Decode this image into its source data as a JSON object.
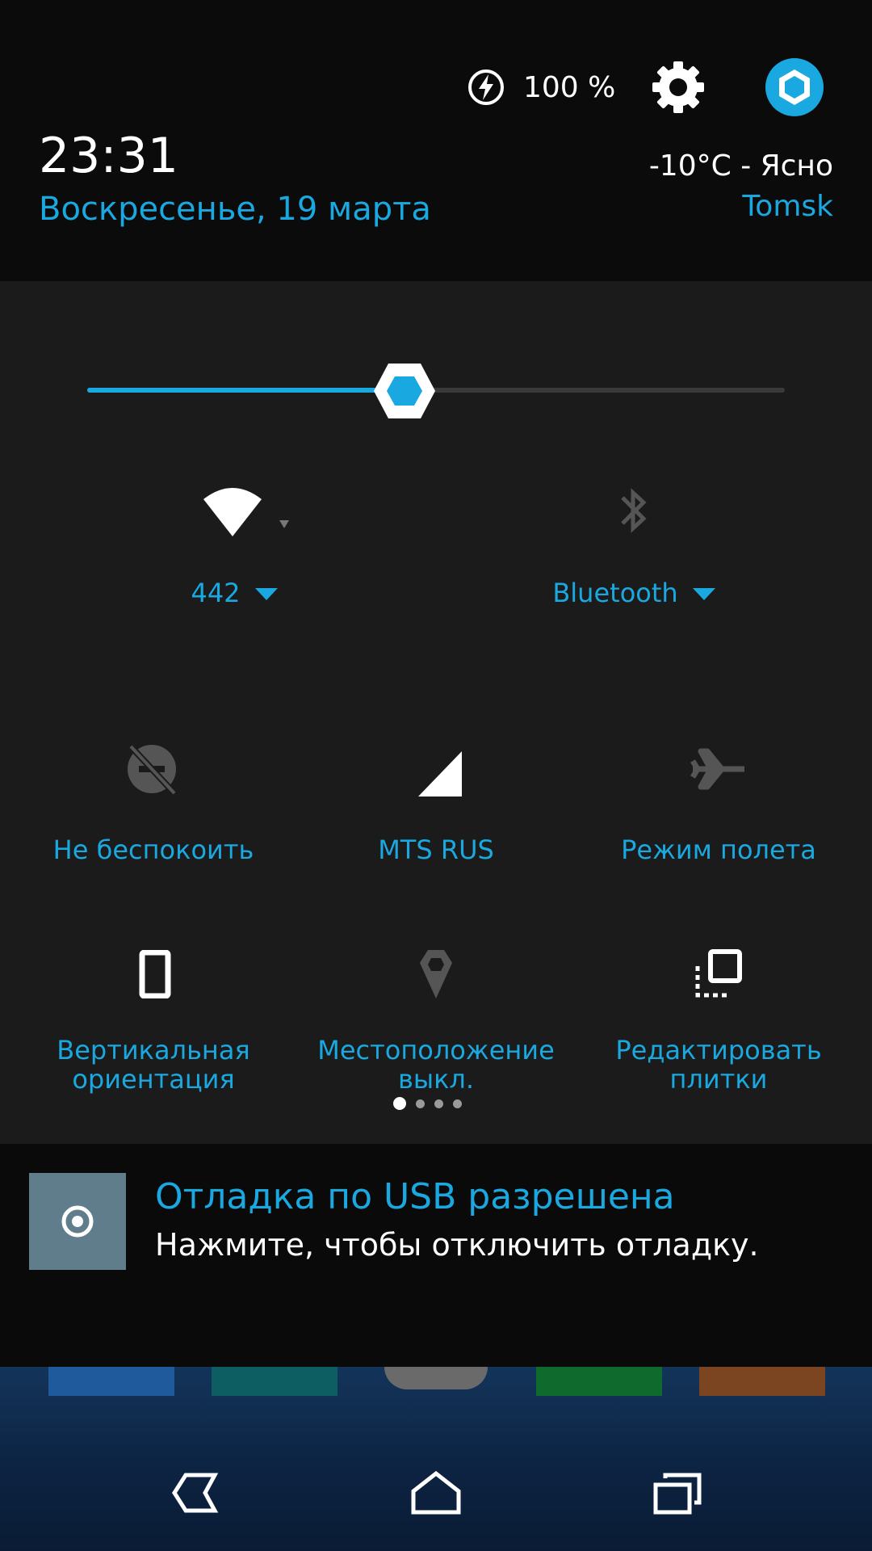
{
  "header": {
    "battery_text": "100 %",
    "clock": "23:31",
    "date": "Воскресенье, 19 марта",
    "weather": "-10°C - Ясно",
    "city": "Tomsk"
  },
  "brightness": {
    "level": 0.455
  },
  "tiles": {
    "wifi_label": "442",
    "bluetooth_label": "Bluetooth",
    "dnd_label": "Не беспокоить",
    "mobile_label": "MTS RUS",
    "airplane_label": "Режим полета",
    "rotation_label_1": "Вертикальная",
    "rotation_label_2": "ориентация",
    "location_label_1": "Местоположение",
    "location_label_2": "выкл.",
    "edit_label_1": "Редактировать",
    "edit_label_2": "плитки"
  },
  "pages": {
    "total": 4,
    "current": 1
  },
  "notification": {
    "title": "Отладка по USB разрешена",
    "text": "Нажмите, чтобы отключить отладку."
  },
  "colors": {
    "accent": "#1aa8e0",
    "header_bg": "#0b0b0b",
    "panel_bg": "#1b1b1b",
    "disabled_icon": "#555555"
  }
}
